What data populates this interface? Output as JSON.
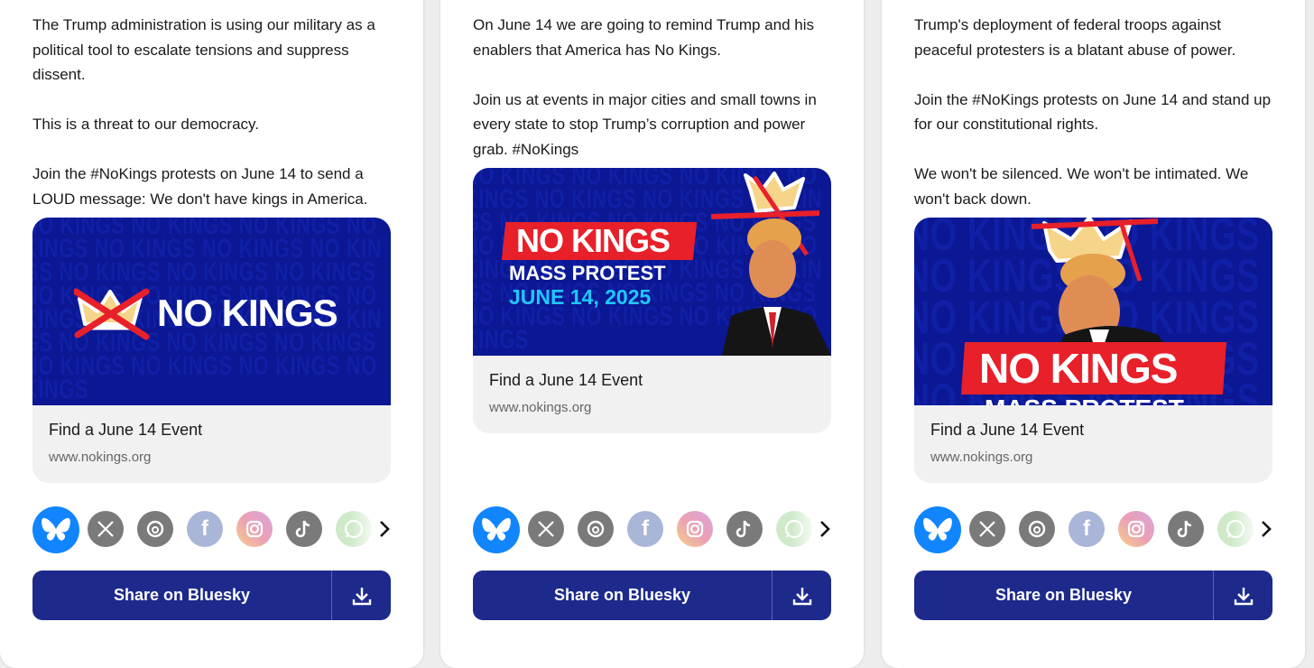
{
  "cards": [
    {
      "paragraphs": [
        "The Trump administration is using our military as a political tool to escalate tensions and suppress dissent.",
        "This is a threat to our democracy.",
        "Join the #NoKings protests on June 14 to send a LOUD message: We don't have kings in America."
      ],
      "image": {
        "banner_text": "NO KINGS",
        "background_text": "NO KINGS"
      },
      "link": {
        "title": "Find a June 14 Event",
        "url": "www.nokings.org"
      },
      "share_label": "Share on Bluesky"
    },
    {
      "paragraphs": [
        "On June 14 we are going to remind Trump and his enablers that America has No Kings.",
        "Join us at events in major cities and small towns in every state to stop Trump’s corruption and power grab.  #NoKings"
      ],
      "image": {
        "line1": "NO KINGS",
        "line2": "MASS PROTEST",
        "line3": "JUNE 14, 2025",
        "background_text": "NO KINGS"
      },
      "link": {
        "title": "Find a June 14 Event",
        "url": "www.nokings.org"
      },
      "share_label": "Share on Bluesky"
    },
    {
      "paragraphs": [
        "Trump's deployment of federal troops against peaceful protesters is a blatant abuse of power.",
        "Join the #NoKings protests on June 14 and stand up for our constitutional rights.",
        "We won't be silenced. We won't be intimated. We won't back down."
      ],
      "image": {
        "banner_text": "NO KINGS",
        "partial_text": "MASS PROTEST",
        "background_text": "NO KINGS"
      },
      "link": {
        "title": "Find a June 14 Event",
        "url": "www.nokings.org"
      },
      "share_label": "Share on Bluesky"
    }
  ],
  "share_icons": [
    "bluesky-icon",
    "x-icon",
    "threads-icon",
    "facebook-icon",
    "instagram-icon",
    "tiktok-icon",
    "whatsapp-icon",
    "chevron-right-icon",
    "download-icon"
  ],
  "colors": {
    "bluesky": "#1185fe",
    "share_button": "#1d2a8c",
    "poster_blue": "#0b1793",
    "banner_red": "#e8202a",
    "accent_cyan": "#20c8ff"
  }
}
